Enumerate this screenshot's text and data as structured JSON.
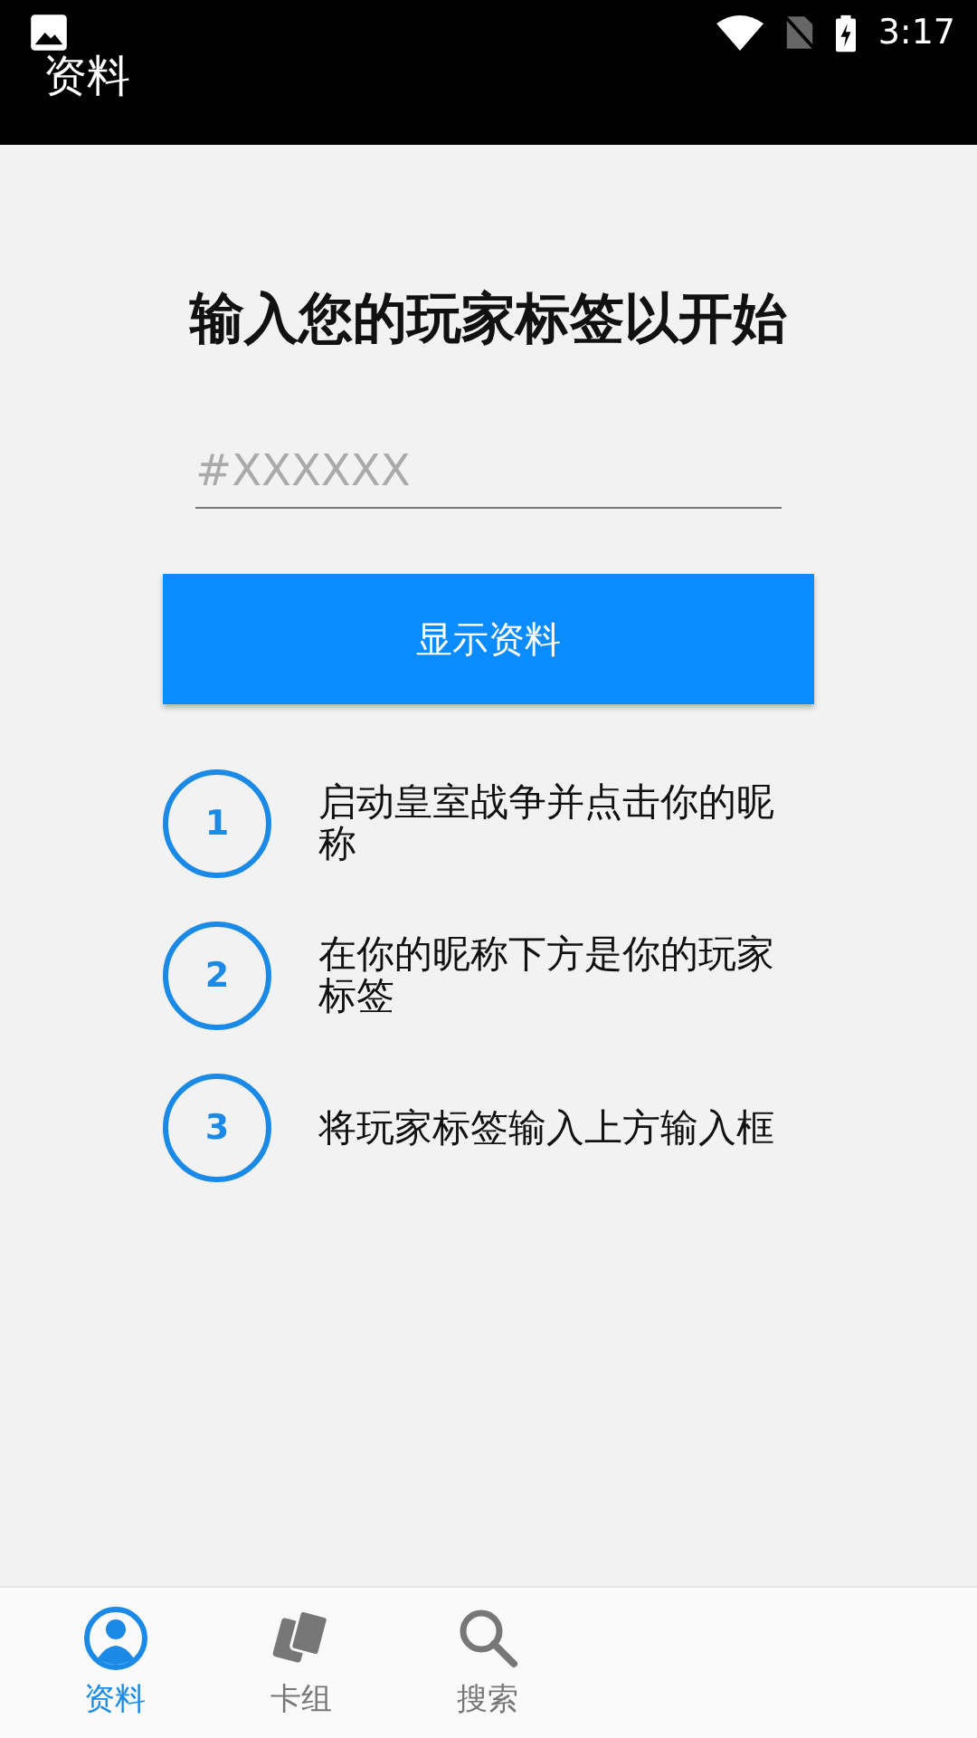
{
  "status_bar": {
    "time": "3:17"
  },
  "app_bar": {
    "title": "资料"
  },
  "heading": "输入您的玩家标签以开始",
  "tag_field": {
    "placeholder": "#XXXXXX"
  },
  "show_button": "显示资料",
  "steps": [
    {
      "number": "1",
      "text": "启动皇室战争并点击你的昵称"
    },
    {
      "number": "2",
      "text": "在你的昵称下方是你的玩家标签"
    },
    {
      "number": "3",
      "text": "将玩家标签输入上方输入框"
    }
  ],
  "tabs": [
    {
      "kind": "profile",
      "label": "资料",
      "selected": true
    },
    {
      "kind": "cards",
      "label": "卡组",
      "selected": false
    },
    {
      "kind": "search",
      "label": "搜索",
      "selected": false
    }
  ]
}
